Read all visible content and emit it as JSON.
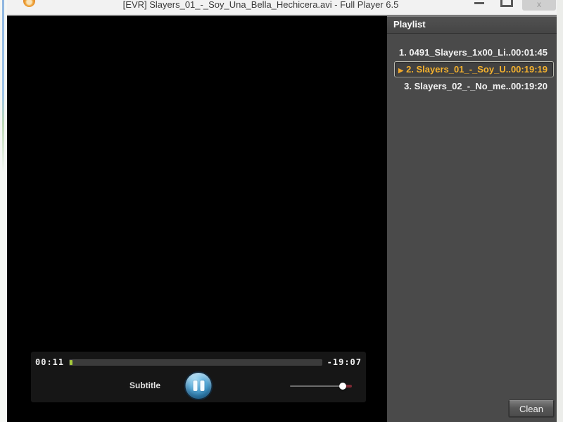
{
  "window": {
    "title": "[EVR] Slayers_01_-_Soy_Una_Bella_Hechicera.avi - Full Player 6.5",
    "controls": {
      "close_glyph": "x"
    }
  },
  "player": {
    "elapsed": "00:11",
    "remaining": "-19:07",
    "progress_percent": 1,
    "subtitle_label": "Subtitle",
    "volume_percent": 85
  },
  "playlist": {
    "header": "Playlist",
    "items": [
      {
        "label": "1. 0491_Slayers_1x00_Li..",
        "duration": "00:01:45",
        "selected": false
      },
      {
        "label": "2. Slayers_01_-_Soy_U..",
        "duration": "00:19:19",
        "selected": true
      },
      {
        "label": "3. Slayers_02_-_No_me..",
        "duration": "00:19:20",
        "selected": false
      }
    ],
    "clean_button": "Clean"
  },
  "colors": {
    "accent_orange": "#f5b22e",
    "pause_blue": "#64b4e0",
    "progress_green": "#a4c83c",
    "volume_red": "#7c2833",
    "panel_gray": "#4a4a4a"
  }
}
